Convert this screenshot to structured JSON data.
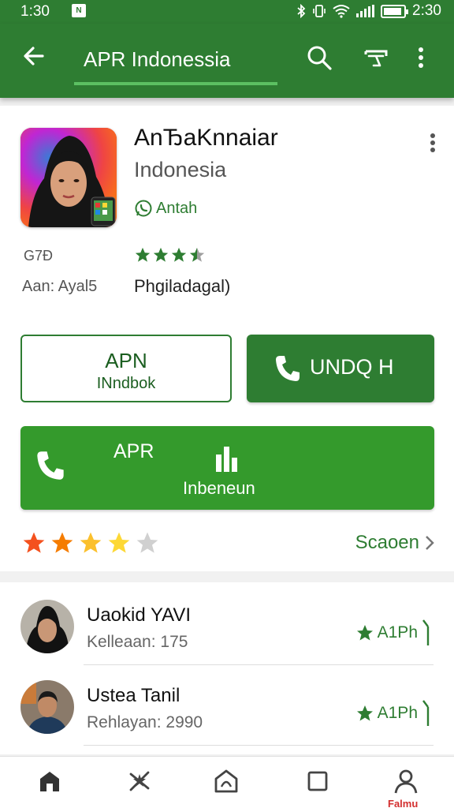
{
  "status_bar": {
    "time_left": "1:30",
    "notification_icon": "n-icon",
    "time_right": "2:30"
  },
  "app_bar": {
    "title": "APR Indonessia",
    "icons": [
      "back-arrow-icon",
      "search-icon",
      "cast-icon",
      "more-vert-icon"
    ]
  },
  "app": {
    "name": "AnЂaKnnaiar",
    "developer": "Indonesia",
    "badge": "Antah",
    "meta_left_1": "G7Ð",
    "meta_left_2": "Aan: Ayal5",
    "stars": 3.5,
    "meta_right": "Phgiladagal)"
  },
  "buttons": {
    "outline_line1": "APN",
    "outline_line2": "INndbok",
    "call_label": "UNDQ  H",
    "wide_line1": "APR",
    "wide_line2": "Inbeneun"
  },
  "rating_row": {
    "stars": 4,
    "link": "Scaoen"
  },
  "reviews": [
    {
      "name": "Uaokid YAVI",
      "sub": "Kelleaan: 175",
      "rate": "A1Ph"
    },
    {
      "name": "Ustea Tanil",
      "sub": "Rehlayan: 2990",
      "rate": "A1Ph"
    }
  ],
  "bottom_nav": {
    "items": [
      "home-icon",
      "star-cross-icon",
      "shop-icon",
      "square-icon",
      "person-icon"
    ],
    "active_label": "Falmu"
  },
  "colors": {
    "primary": "#2e7d32",
    "primary_light": "#349a2c",
    "star_orange": "#f57c00",
    "star_yellow": "#fbc02d",
    "link": "#2e7d32"
  }
}
